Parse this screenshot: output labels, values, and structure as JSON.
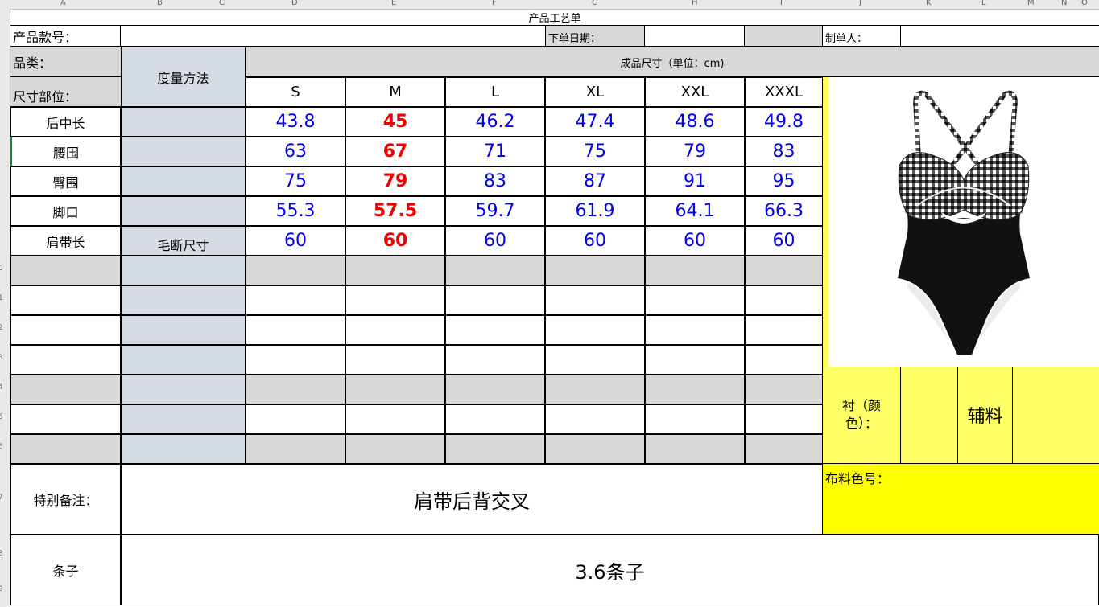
{
  "columns": [
    "A",
    "B",
    "C",
    "D",
    "E",
    "F",
    "G",
    "H",
    "I",
    "J",
    "K",
    "L",
    "M",
    "N",
    "O"
  ],
  "rows": [
    "0",
    "1",
    "2",
    "3",
    "4",
    "5",
    "6",
    "7",
    "8",
    "9"
  ],
  "sheet": {
    "title": "产品工艺单",
    "style_no_label": "产品款号：",
    "order_date_label": "下单日期：",
    "maker_label": "制单人：",
    "category_label": "品类：",
    "size_part_label": "尺寸部位：",
    "measure_method_label": "度量方法",
    "finished_size_label": "成品尺寸（单位：cm)",
    "raw_size_note": "毛断尺寸",
    "lining_color_label": "衬（颜色）：",
    "accessory_label": "辅料",
    "fabric_color_label": "布料色号：",
    "special_note_label": "特别备注：",
    "special_note_value": "肩带后背交叉",
    "strip_label": "条子",
    "strip_value": "3.6条子"
  },
  "sizes": [
    "S",
    "M",
    "L",
    "XL",
    "XXL",
    "XXXL"
  ],
  "measurements": [
    {
      "part": "后中长",
      "values": [
        "43.8",
        "45",
        "46.2",
        "47.4",
        "48.6",
        "49.8"
      ]
    },
    {
      "part": "腰围",
      "values": [
        "63",
        "67",
        "71",
        "75",
        "79",
        "83"
      ]
    },
    {
      "part": "臀围",
      "values": [
        "75",
        "79",
        "83",
        "87",
        "91",
        "95"
      ]
    },
    {
      "part": "脚口",
      "values": [
        "55.3",
        "57.5",
        "59.7",
        "61.9",
        "64.1",
        "66.3"
      ]
    },
    {
      "part": "肩带长",
      "values": [
        "60",
        "60",
        "60",
        "60",
        "60",
        "60"
      ]
    }
  ],
  "colors": {
    "highlight_size": "#ee0000",
    "values": "#0000ee",
    "yellow": "#ffff66",
    "bright_yellow": "#ffff00",
    "gray": "#d8d8d8",
    "blue_gray": "#d6dce4"
  }
}
